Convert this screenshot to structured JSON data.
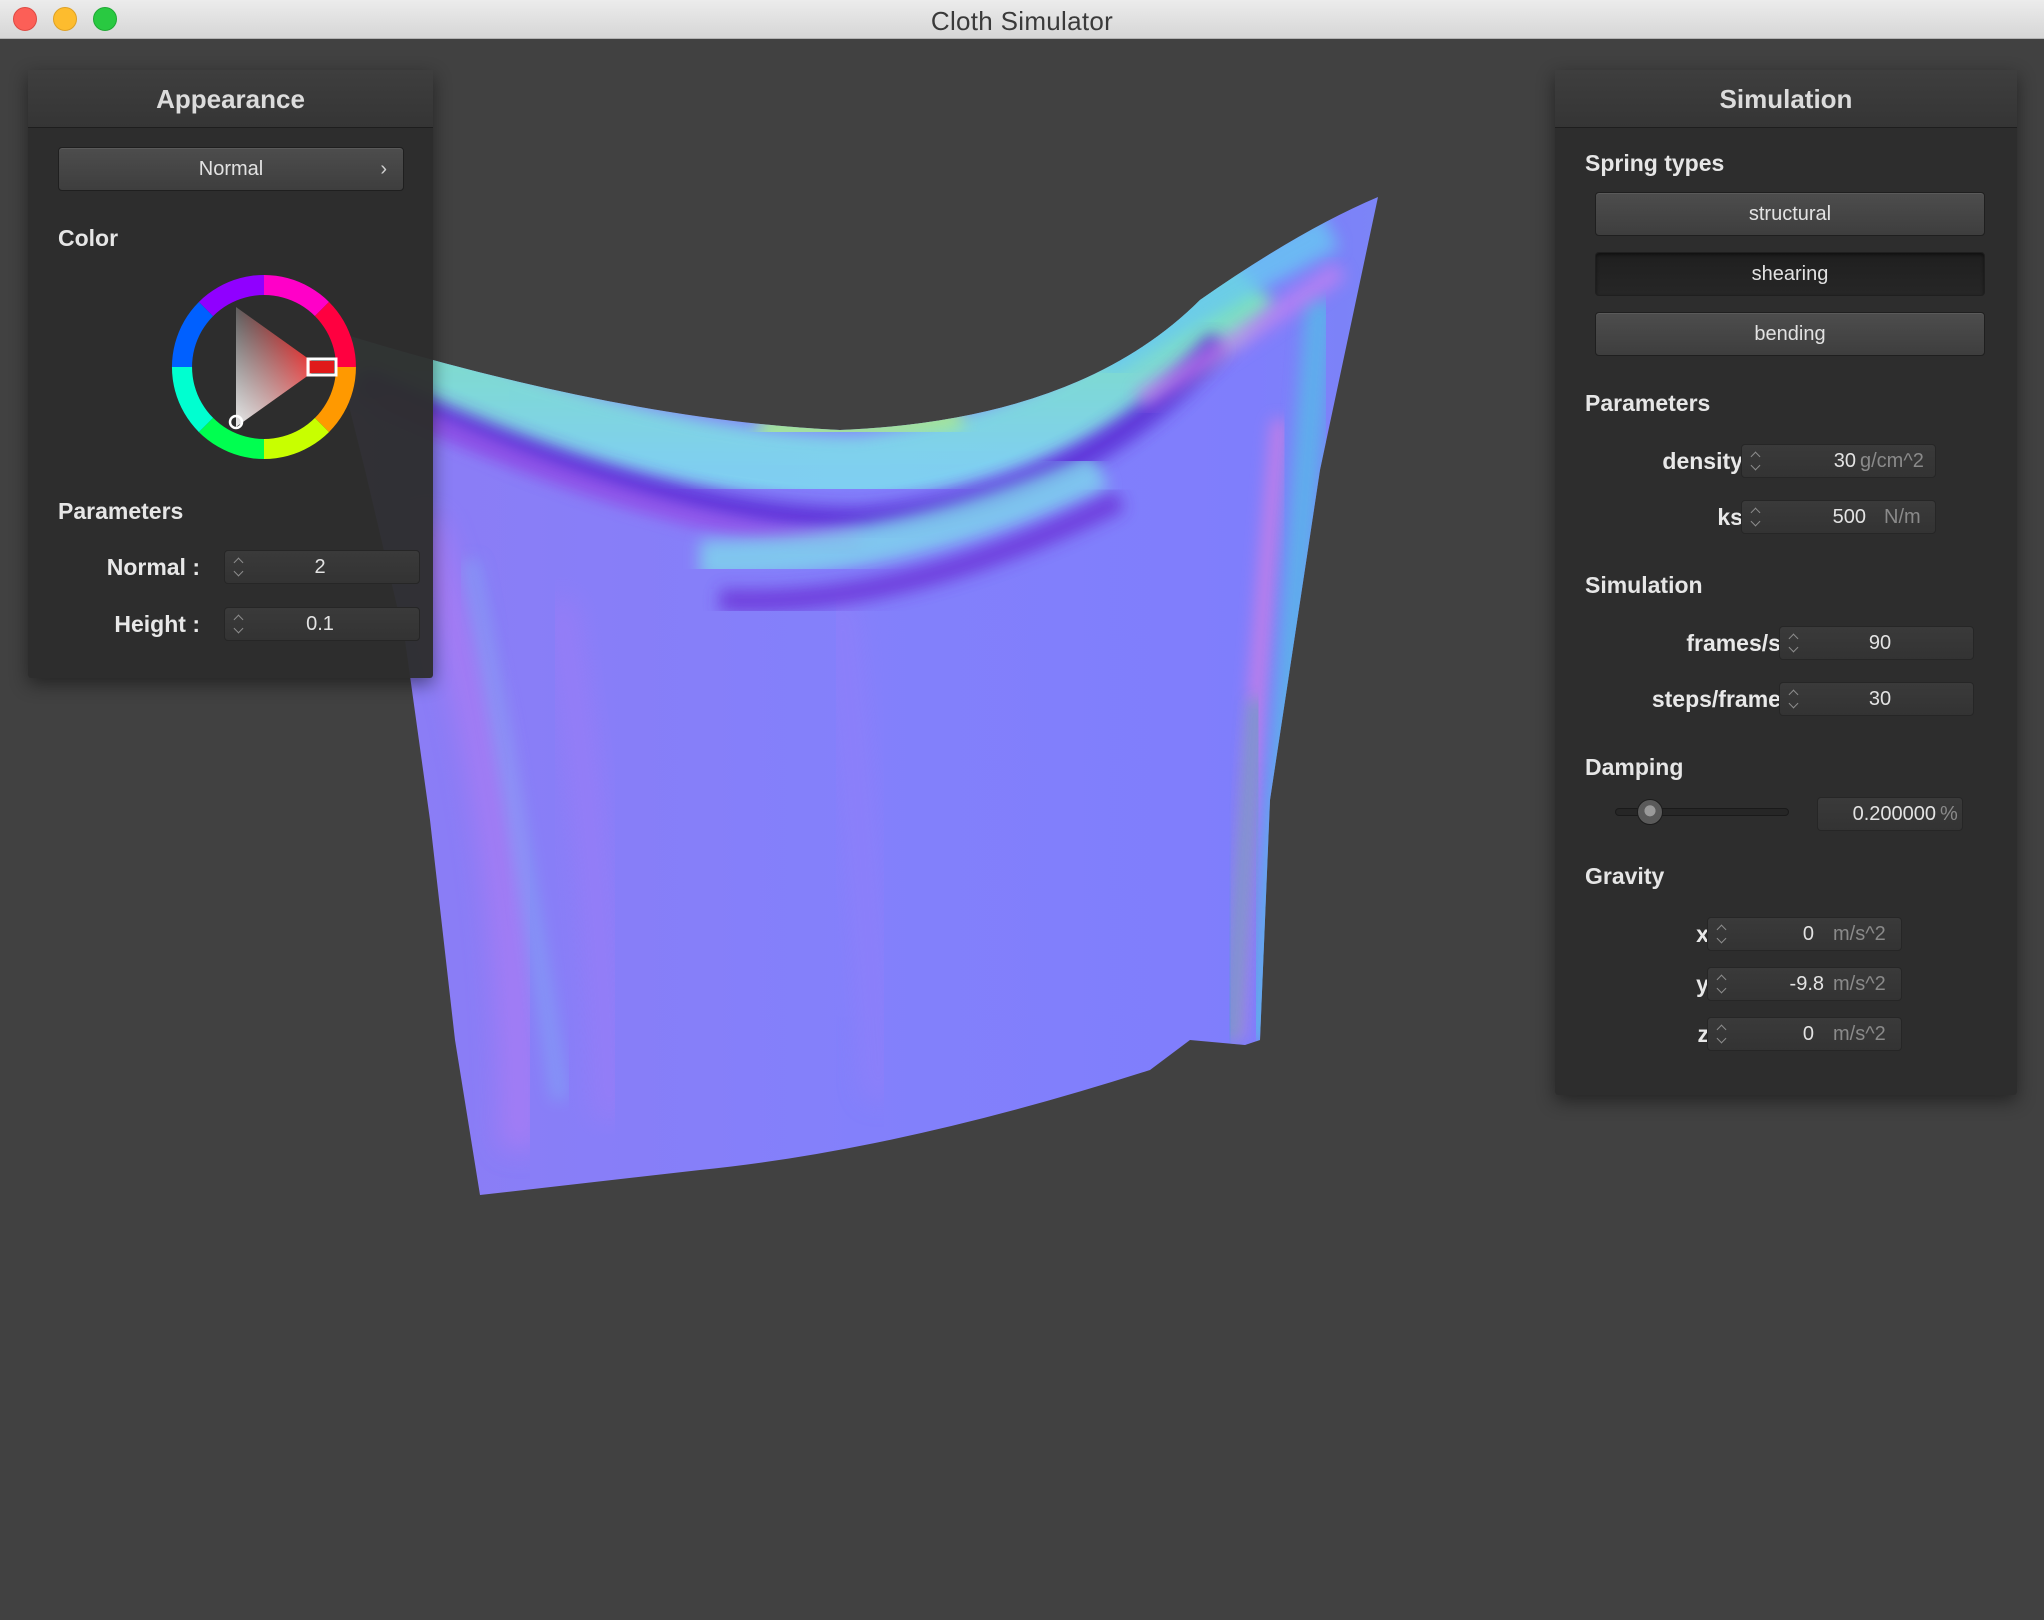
{
  "window": {
    "title": "Cloth Simulator"
  },
  "appearance": {
    "title": "Appearance",
    "shader_dropdown": "Normal",
    "color_label": "Color",
    "params_label": "Parameters",
    "normal_label": "Normal :",
    "normal_value": "2",
    "height_label": "Height :",
    "height_value": "0.1",
    "selected_color": "#ff0000"
  },
  "simulation": {
    "title": "Simulation",
    "spring_types_label": "Spring types",
    "spring_types": [
      {
        "label": "structural",
        "pressed": false
      },
      {
        "label": "shearing",
        "pressed": true
      },
      {
        "label": "bending",
        "pressed": false
      }
    ],
    "parameters_label": "Parameters",
    "density_label": "density :",
    "density_value": "30",
    "density_unit": "g/cm^2",
    "ks_label": "ks :",
    "ks_value": "500",
    "ks_unit": "N/m",
    "simulation_label": "Simulation",
    "fps_label": "frames/s :",
    "fps_value": "90",
    "steps_label": "steps/frame :",
    "steps_value": "30",
    "damping_label": "Damping",
    "damping_value": "0.200000",
    "damping_unit": "%",
    "damping_slider_fraction": 0.2,
    "gravity_label": "Gravity",
    "gx_label": "x :",
    "gx_value": "0",
    "gy_label": "y :",
    "gy_value": "-9.8",
    "gz_label": "z :",
    "gz_value": "0",
    "gravity_unit": "m/s^2"
  },
  "colors": {
    "background": "#414141",
    "cloth_base": "#8080ff"
  }
}
